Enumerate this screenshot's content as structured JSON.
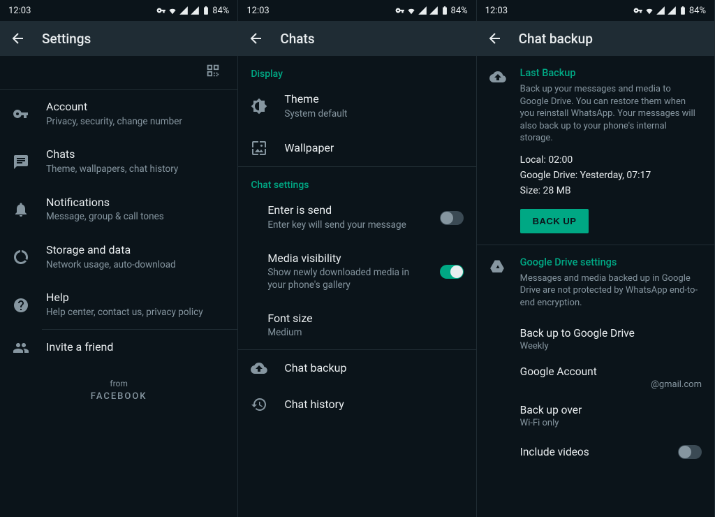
{
  "status": {
    "time": "12:03",
    "battery": "84%"
  },
  "panel1": {
    "title": "Settings",
    "items": [
      {
        "primary": "Account",
        "secondary": "Privacy, security, change number"
      },
      {
        "primary": "Chats",
        "secondary": "Theme, wallpapers, chat history"
      },
      {
        "primary": "Notifications",
        "secondary": "Message, group & call tones"
      },
      {
        "primary": "Storage and data",
        "secondary": "Network usage, auto-download"
      },
      {
        "primary": "Help",
        "secondary": "Help center, contact us, privacy policy"
      },
      {
        "primary": "Invite a friend"
      }
    ],
    "from": "from",
    "facebook": "FACEBOOK"
  },
  "panel2": {
    "title": "Chats",
    "display_header": "Display",
    "theme": {
      "primary": "Theme",
      "secondary": "System default"
    },
    "wallpaper": "Wallpaper",
    "chat_settings_header": "Chat settings",
    "enter_send": {
      "primary": "Enter is send",
      "secondary": "Enter key will send your message"
    },
    "media_vis": {
      "primary": "Media visibility",
      "secondary": "Show newly downloaded media in your phone's gallery"
    },
    "font_size": {
      "primary": "Font size",
      "secondary": "Medium"
    },
    "chat_backup": "Chat backup",
    "chat_history": "Chat history"
  },
  "panel3": {
    "title": "Chat backup",
    "last_backup": {
      "title": "Last Backup",
      "desc": "Back up your messages and media to Google Drive. You can restore them when you reinstall WhatsApp. Your messages will also back up to your phone's internal storage.",
      "local": "Local: 02:00",
      "drive": "Google Drive: Yesterday, 07:17",
      "size": "Size: 28 MB",
      "button": "BACK UP"
    },
    "gds": {
      "title": "Google Drive settings",
      "desc": "Messages and media backed up in Google Drive are not protected by WhatsApp end-to-end encryption.",
      "backup_to": {
        "primary": "Back up to Google Drive",
        "secondary": "Weekly"
      },
      "account": {
        "primary": "Google Account",
        "secondary": "@gmail.com"
      },
      "backup_over": {
        "primary": "Back up over",
        "secondary": "Wi-Fi only"
      },
      "include_videos": "Include videos"
    }
  }
}
